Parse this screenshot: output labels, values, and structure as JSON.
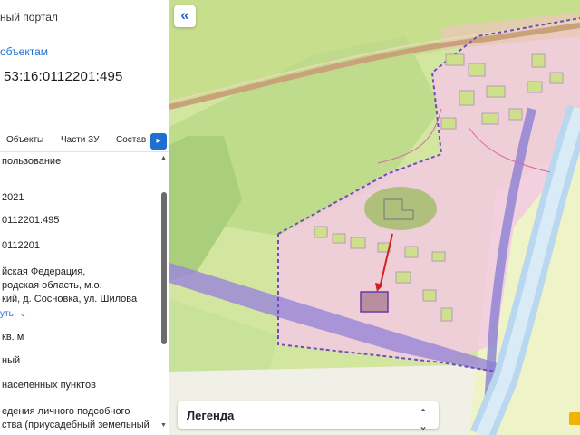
{
  "panel": {
    "portal_title": "ный портал",
    "back_link": "объектам",
    "cadastral_number": "53:16:0112201:495",
    "tabs": [
      "Объекты",
      "Части ЗУ",
      "Состав"
    ],
    "fields": [
      "пользование",
      "2021",
      "0112201:495",
      "0112201",
      "йская Федерация,",
      "родская область, м.о.",
      "кий, д. Сосновка, ул. Шилова",
      "кв. м",
      "ный",
      "населенных пунктов",
      "едения личного подсобного",
      "ства (приусадебный земельный"
    ],
    "show_more": "уть"
  },
  "map": {
    "legend_label": "Легенда"
  }
}
